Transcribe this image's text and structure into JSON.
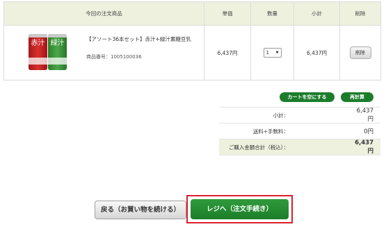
{
  "table": {
    "headers": {
      "product": "今回の注文商品",
      "unit_price": "単価",
      "quantity": "数量",
      "subtotal": "小計",
      "delete": "削除"
    },
    "items": [
      {
        "name": "【アソート36本セット】赤汁+緑汁薫糖豆乳",
        "code": "商品番号：1005100036",
        "can_labels": [
          "赤汁",
          "緑汁"
        ],
        "unit_price": "6,437円",
        "quantity": "1",
        "subtotal": "6,437円",
        "delete_label": "削除"
      }
    ]
  },
  "actions": {
    "empty_cart": "カートを空にする",
    "recalculate": "再計算"
  },
  "summary": {
    "subtotal_label": "小計：",
    "subtotal_value": "6,437円",
    "fee_label": "送料+手数料：",
    "fee_value": "0円",
    "total_label": "ご購入金額合計（税込）：",
    "total_value": "6,437円"
  },
  "footer": {
    "back_label": "戻る（お買い物を続ける）",
    "checkout_label": "レジへ（注文手続き）"
  },
  "colors": {
    "accent_green": "#1b7d2c",
    "header_bg": "#eef1de",
    "highlight_red": "#d8202a"
  }
}
